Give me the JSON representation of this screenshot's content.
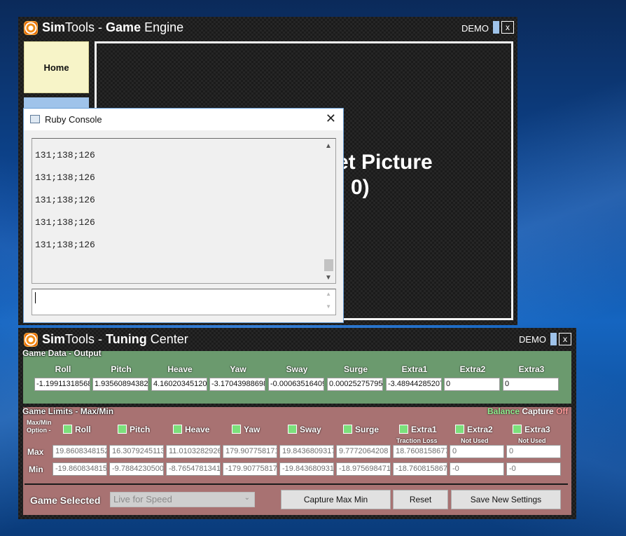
{
  "engine": {
    "title_a": "Sim",
    "title_b": "Tools",
    "title_sep": " - ",
    "title_c": "Game",
    "title_d": " Engine",
    "demo": "DEMO",
    "close": "x",
    "home_button": "Home",
    "picture_text_1": "et Picture",
    "picture_text_2": "0)"
  },
  "ruby": {
    "title": "Ruby Console",
    "close": "✕",
    "lines": [
      "131;138;126",
      "131;138;126",
      "131;138;126",
      "131;138;126",
      "131;138;126"
    ],
    "scroll_up": "▲",
    "scroll_down": "▼",
    "input_up": "▲",
    "input_down": "▼"
  },
  "tuning": {
    "title_a": "Sim",
    "title_b": "Tools",
    "title_sep": " - ",
    "title_c": "Tuning",
    "title_d": " Center",
    "demo": "DEMO",
    "close": "x",
    "output_label": "Game Data - Output",
    "columns": [
      "Roll",
      "Pitch",
      "Heave",
      "Yaw",
      "Sway",
      "Surge",
      "Extra1",
      "Extra2",
      "Extra3"
    ],
    "output_values": [
      "-1.19911318568",
      "1.93560894382",
      "4.16020345120",
      "-3.17043988698",
      "-0.00063516409",
      "0.00025275795",
      "-3.48944285207",
      "0",
      "0"
    ],
    "limits_label": "Game Limits - Max/Min",
    "balance": "Balance",
    "capture": "Capture",
    "off": "Off",
    "maxmin_option_1": "Max/Min",
    "maxmin_option_2": "Option -",
    "sub_labels": [
      "Traction Loss",
      "Not Used",
      "Not Used"
    ],
    "max_label": "Max",
    "min_label": "Min",
    "max_values": [
      "19.8608348152",
      "16.3079245113",
      "11.0103282926",
      "179.907758171",
      "19.8436809317",
      "9.7772064208",
      "18.7608158677",
      "0",
      "0"
    ],
    "min_values": [
      "-19.860834815",
      "-9.7884230500",
      "-8.7654781341",
      "-179.90775817",
      "-19.843680931",
      "-18.975698471",
      "-18.760815867",
      "-0",
      "-0"
    ],
    "game_selected_label": "Game Selected",
    "game_selected_value": "Live for Speed",
    "capture_button": "Capture Max Min",
    "reset_button": "Reset",
    "save_button": "Save New Settings"
  }
}
